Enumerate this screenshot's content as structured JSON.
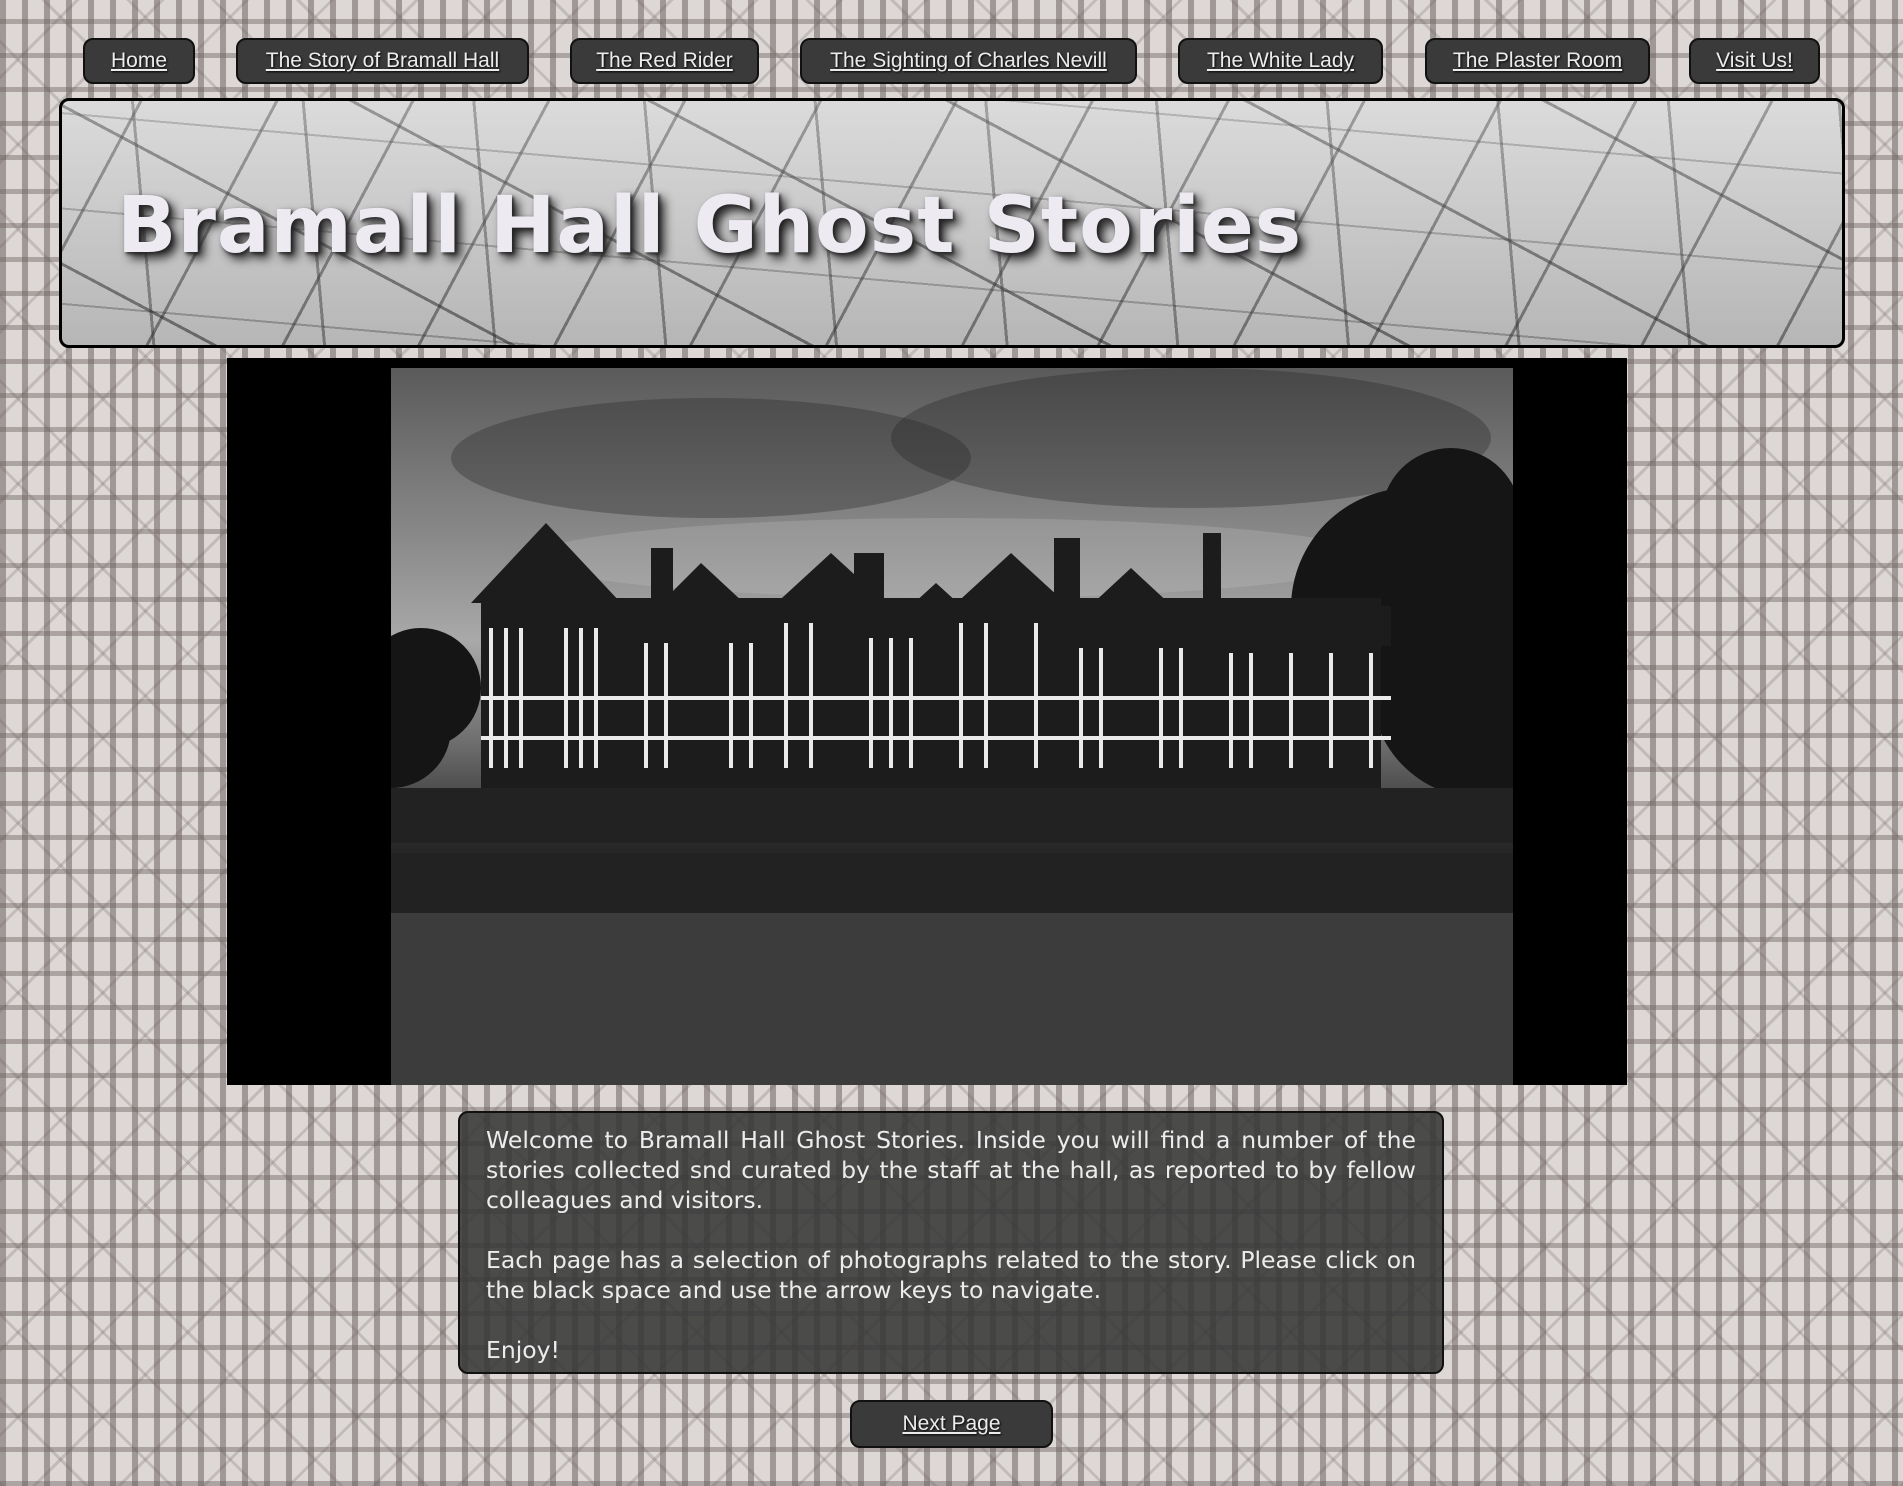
{
  "nav": {
    "items": [
      {
        "label": "Home"
      },
      {
        "label": "The Story of Bramall Hall"
      },
      {
        "label": "The Red Rider"
      },
      {
        "label": "The Sighting of Charles Nevill"
      },
      {
        "label": "The White Lady"
      },
      {
        "label": "The Plaster Room"
      },
      {
        "label": "Visit Us!"
      }
    ]
  },
  "header": {
    "title": "Bramall Hall Ghost Stories",
    "background": "hand-drawn-map"
  },
  "gallery": {
    "image": "black-and-white photograph of Bramall Hall, timber-framed Tudor house with lawns and hedges"
  },
  "intro": {
    "paragraphs": [
      "Welcome to Bramall Hall Ghost Stories. Inside you will find a number of the stories collected snd curated by the staff at the hall, as reported to by fellow colleagues and visitors.",
      "Each page has a selection of photographs related to the story. Please click on the black space and use the arrow keys to navigate.",
      "Enjoy!"
    ]
  },
  "next_page": {
    "label": "Next Page"
  },
  "colors": {
    "button_bg": "#3a3a3a",
    "button_text": "#ececec",
    "panel_bg": "#373737",
    "pattern": "#6e6462"
  }
}
